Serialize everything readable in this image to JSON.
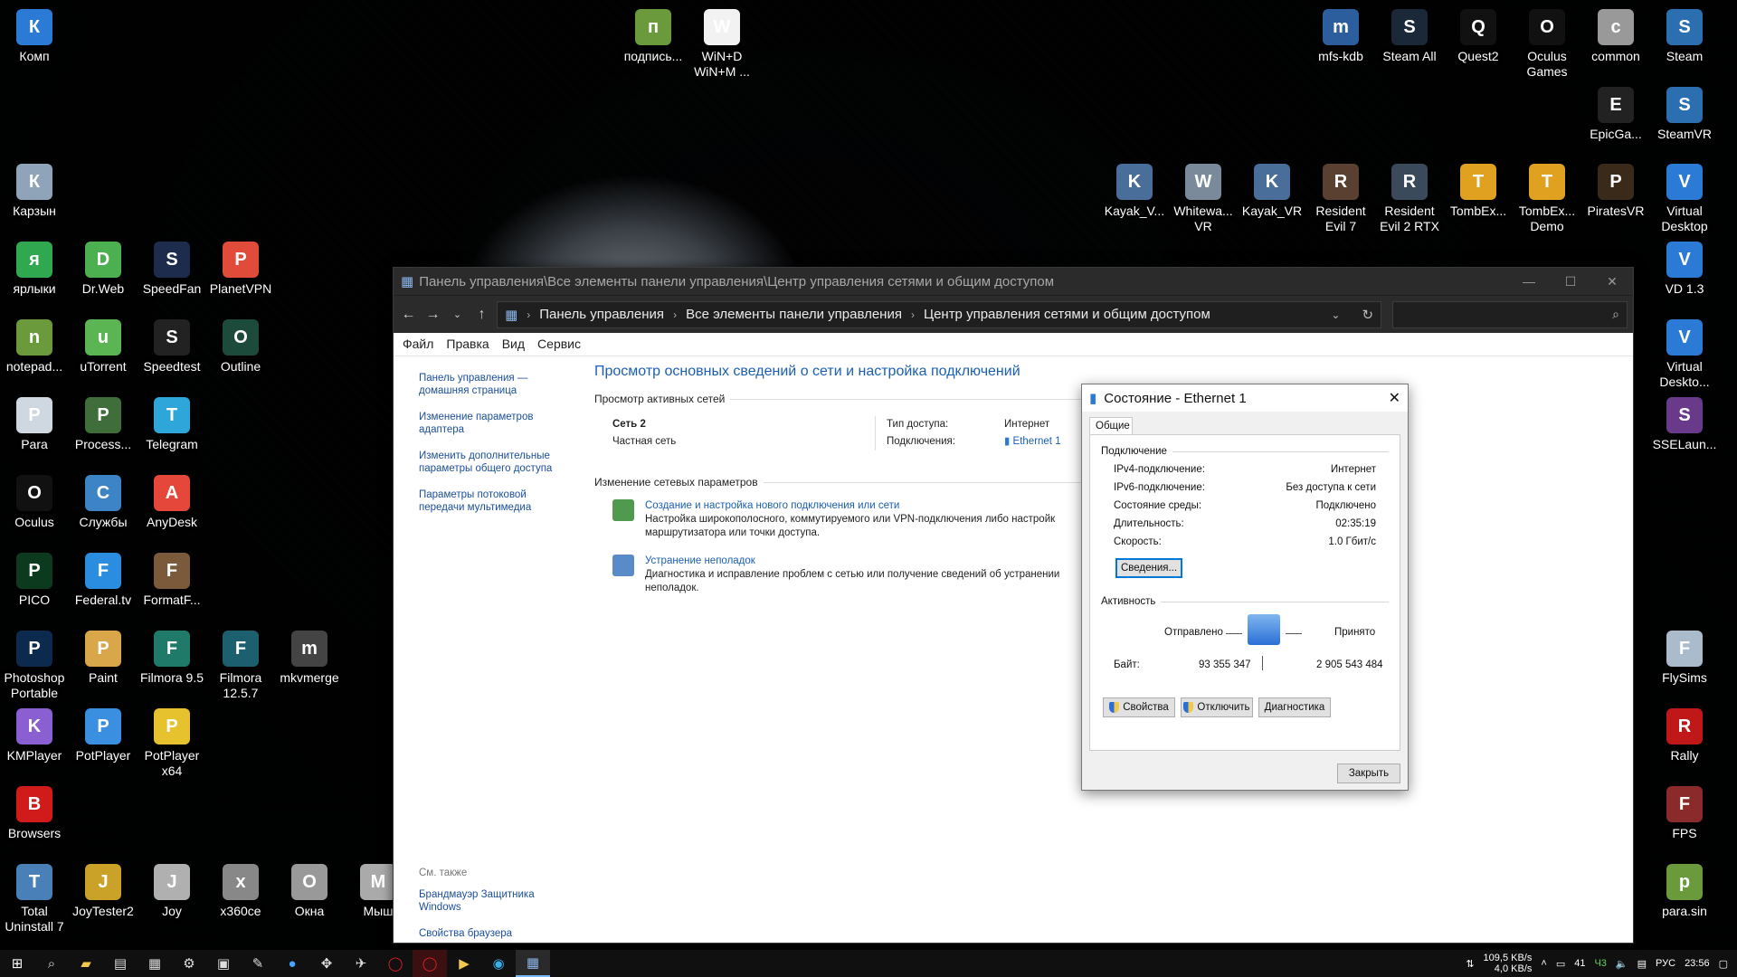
{
  "desktop": {
    "icons": [
      {
        "label": "Комп",
        "color": "#2b7bd6"
      },
      {
        "label": "Карзын",
        "color": "#8fa4b8"
      },
      {
        "label": "ярлыки",
        "color": "#2fa84f"
      },
      {
        "label": "Dr.Web",
        "color": "#4caf50"
      },
      {
        "label": "SpeedFan",
        "color": "#1d2c4d"
      },
      {
        "label": "PlanetVPN",
        "color": "#e04b3a"
      },
      {
        "label": "notepad...",
        "color": "#6a9a3c"
      },
      {
        "label": "uTorrent",
        "color": "#5ab552"
      },
      {
        "label": "Speedtest",
        "color": "#222"
      },
      {
        "label": "Outline",
        "color": "#1c4a3b"
      },
      {
        "label": "Para",
        "color": "#cfd8e0"
      },
      {
        "label": "Process...",
        "color": "#3f6e3a"
      },
      {
        "label": "Telegram",
        "color": "#2ea6da"
      },
      {
        "label": "Oculus",
        "color": "#111"
      },
      {
        "label": "Службы",
        "color": "#3d84c6"
      },
      {
        "label": "AnyDesk",
        "color": "#e5473a"
      },
      {
        "label": "PICO",
        "color": "#0b3a1f"
      },
      {
        "label": "Federal.tv",
        "color": "#2b8de0"
      },
      {
        "label": "FormatF...",
        "color": "#7a5a3a"
      },
      {
        "label": "Photoshop Portable",
        "color": "#0c2a4d"
      },
      {
        "label": "Paint",
        "color": "#d9a74a"
      },
      {
        "label": "Filmora 9.5",
        "color": "#1f7a6a"
      },
      {
        "label": "Filmora 12.5.7",
        "color": "#1c5f6e"
      },
      {
        "label": "mkvmerge",
        "color": "#444"
      },
      {
        "label": "KMPlayer",
        "color": "#8a5fd1"
      },
      {
        "label": "PotPlayer",
        "color": "#3b8fe0"
      },
      {
        "label": "PotPlayer x64",
        "color": "#e6c22e"
      },
      {
        "label": "Browsers",
        "color": "#d11b1b"
      },
      {
        "label": "Total Uninstall 7",
        "color": "#4a80b8"
      },
      {
        "label": "JoyTester2",
        "color": "#c9a227"
      },
      {
        "label": "Joy",
        "color": "#b0b0b0"
      },
      {
        "label": "x360ce",
        "color": "#888"
      },
      {
        "label": "Окна",
        "color": "#999"
      },
      {
        "label": "Мыш",
        "color": "#aaa"
      },
      {
        "label": "подпись...",
        "color": "#6a9a3c"
      },
      {
        "label": "WiN+D WiN+M ...",
        "color": "#f2f2f2"
      },
      {
        "label": "mfs-kdb",
        "color": "#2c5e9e"
      },
      {
        "label": "Steam All",
        "color": "#1b2838"
      },
      {
        "label": "Quest2",
        "color": "#111"
      },
      {
        "label": "Oculus Games",
        "color": "#111"
      },
      {
        "label": "common",
        "color": "#999"
      },
      {
        "label": "Steam",
        "color": "#2b6fb0"
      },
      {
        "label": "EpicGa...",
        "color": "#222"
      },
      {
        "label": "SteamVR",
        "color": "#2b6fb0"
      },
      {
        "label": "Kayak_V...",
        "color": "#4a6e9a"
      },
      {
        "label": "Whitewa... VR",
        "color": "#7a8a9a"
      },
      {
        "label": "Kayak_VR",
        "color": "#4a6e9a"
      },
      {
        "label": "Resident Evil 7",
        "color": "#5a4030"
      },
      {
        "label": "Resident Evil 2 RTX",
        "color": "#3a4a5a"
      },
      {
        "label": "TombEx...",
        "color": "#e0a020"
      },
      {
        "label": "TombEx... Demo",
        "color": "#e0a020"
      },
      {
        "label": "PiratesVR",
        "color": "#3a2a1a"
      },
      {
        "label": "Virtual Desktop",
        "color": "#2b7bd6"
      },
      {
        "label": "VD 1.3",
        "color": "#2b7bd6"
      },
      {
        "label": "Virtual Deskto...",
        "color": "#2b7bd6"
      },
      {
        "label": "SSELaun...",
        "color": "#6a3a8a"
      },
      {
        "label": "FlySims",
        "color": "#aabbcc"
      },
      {
        "label": "Rally",
        "color": "#c01818"
      },
      {
        "label": "FPS",
        "color": "#8a2a2a"
      },
      {
        "label": "para.sin",
        "color": "#6a9a3c"
      }
    ]
  },
  "window": {
    "title": "Панель управления\\Все элементы панели управления\\Центр управления сетями и общим доступом",
    "breadcrumb": [
      "Панель управления",
      "Все элементы панели управления",
      "Центр управления сетями и общим доступом"
    ],
    "menu": [
      "Файл",
      "Правка",
      "Вид",
      "Сервис"
    ],
    "left_links": [
      "Панель управления — домашняя страница",
      "Изменение параметров адаптера",
      "Изменить дополнительные параметры общего доступа",
      "Параметры потоковой передачи мультимедиа"
    ],
    "see_also_header": "См. также",
    "see_also": [
      "Брандмауэр Защитника Windows",
      "Свойства браузера"
    ],
    "heading": "Просмотр основных сведений о сети и настройка подключений",
    "active_header": "Просмотр активных сетей",
    "network_name": "Сеть 2",
    "network_type": "Частная сеть",
    "access_label": "Тип доступа:",
    "access_value": "Интернет",
    "conn_label": "Подключения:",
    "conn_value": "Ethernet 1",
    "change_header": "Изменение сетевых параметров",
    "task1_title": "Создание и настройка нового подключения или сети",
    "task1_desc": "Настройка широкополосного, коммутируемого или VPN-подключения либо настройк маршрутизатора или точки доступа.",
    "task2_title": "Устранение неполадок",
    "task2_desc": "Диагностика и исправление проблем с сетью или получение сведений об устранении неполадок."
  },
  "dialog": {
    "title": "Состояние - Ethernet 1",
    "tab": "Общие",
    "conn_group": "Подключение",
    "rows": [
      {
        "k": "IPv4-подключение:",
        "v": "Интернет"
      },
      {
        "k": "IPv6-подключение:",
        "v": "Без доступа к сети"
      },
      {
        "k": "Состояние среды:",
        "v": "Подключено"
      },
      {
        "k": "Длительность:",
        "v": "02:35:19"
      },
      {
        "k": "Скорость:",
        "v": "1.0 Гбит/с"
      }
    ],
    "details_btn": "Сведения...",
    "activity_group": "Активность",
    "sent_label": "Отправлено",
    "recv_label": "Принято",
    "bytes_label": "Байт:",
    "bytes_sent": "93 355 347",
    "bytes_recv": "2 905 543 484",
    "props_btn": "Свойства",
    "disable_btn": "Отключить",
    "diag_btn": "Диагностика",
    "close_btn": "Закрыть"
  },
  "tray": {
    "up_speed": "109,5 KB/s",
    "down_speed": "4,0 KB/s",
    "temp": "41",
    "temp2": "Ч3",
    "lang": "РУС",
    "time": "23:56"
  }
}
